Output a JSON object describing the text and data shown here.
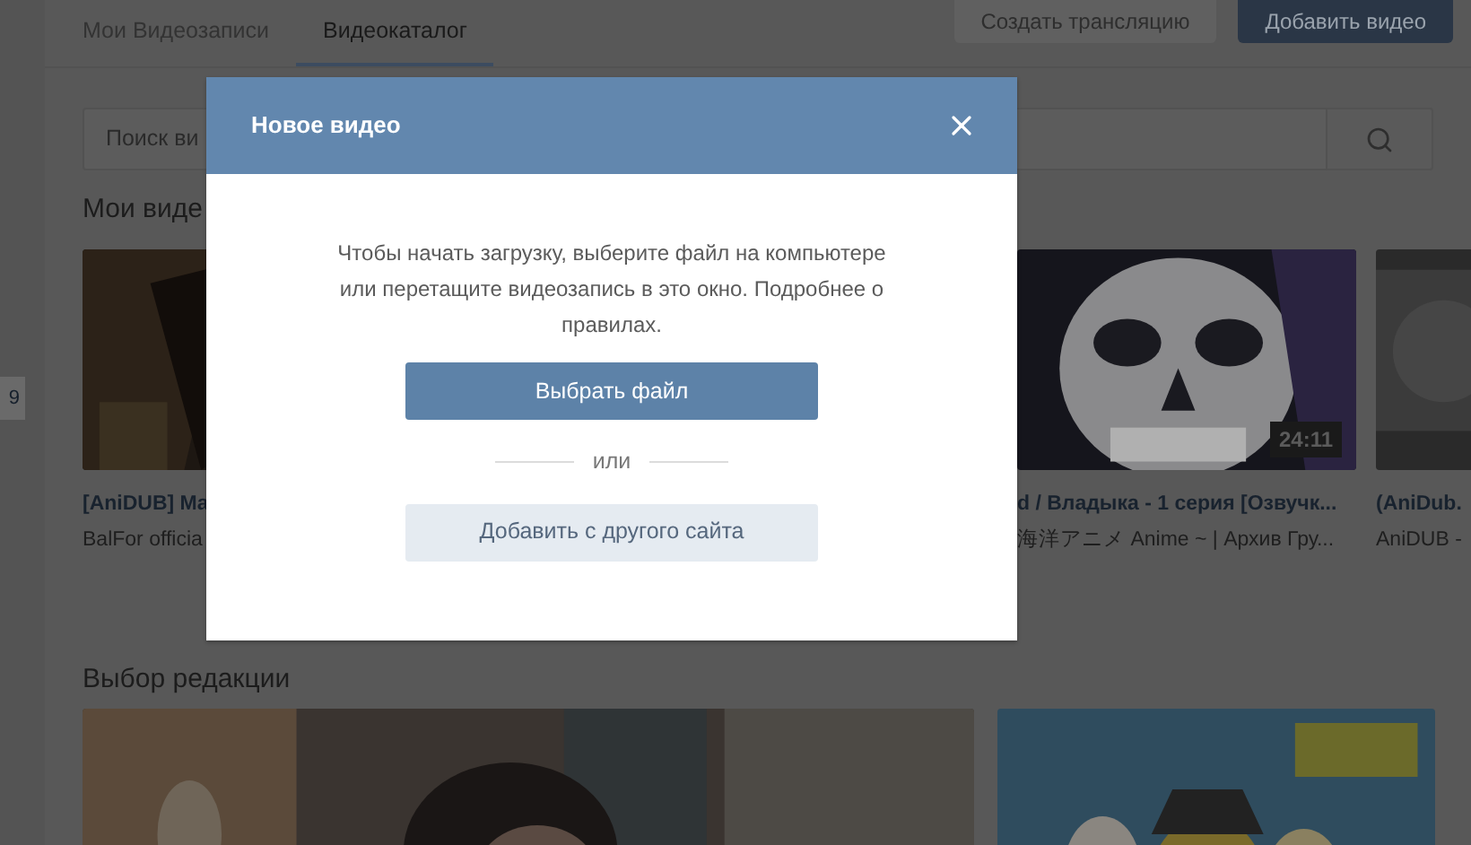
{
  "tabs": [
    {
      "label": "Мои Видеозаписи",
      "selected": false
    },
    {
      "label": "Видеокаталог",
      "selected": true
    }
  ],
  "header_buttons": [
    "Создать трансляцию",
    "Добавить видео"
  ],
  "side_badge": "9",
  "search": {
    "placeholder": "Поиск ви"
  },
  "sections": [
    {
      "title": "Мои виде",
      "videos": [
        {
          "title": "[AniDUB] Ma",
          "channel": "BalFor officia"
        },
        {
          "title": "d / Владыка - 1 серия [Озвучк...",
          "channel": "海洋アニメ Anime ~ | Архив Гру...",
          "duration": "24:11"
        },
        {
          "title": "(AniDub.",
          "channel": "AniDUB -"
        }
      ]
    },
    {
      "title": "Выбор редакции"
    }
  ],
  "modal": {
    "title": "Новое видео",
    "message": "Чтобы начать загрузку, выберите файл на компьютере или перетащите видеозапись в это окно. Подробнее о правилах.",
    "primary_button": "Выбрать файл",
    "separator": "или",
    "secondary_button": "Добавить с другого сайта"
  }
}
